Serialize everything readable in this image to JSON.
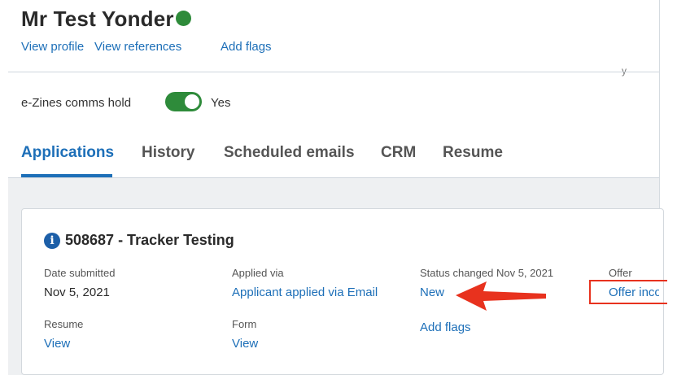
{
  "header": {
    "name": "Mr Test Yonder",
    "links": {
      "view_profile": "View profile",
      "view_references": "View references",
      "add_flags": "Add flags"
    }
  },
  "comms": {
    "label": "e-Zines comms hold",
    "toggle_on": true,
    "value": "Yes"
  },
  "tabs": [
    {
      "label": "Applications",
      "active": true
    },
    {
      "label": "History",
      "active": false
    },
    {
      "label": "Scheduled emails",
      "active": false
    },
    {
      "label": "CRM",
      "active": false
    },
    {
      "label": "Resume",
      "active": false
    }
  ],
  "application": {
    "title": "508687 - Tracker Testing",
    "date_submitted": {
      "label": "Date submitted",
      "value": "Nov 5, 2021"
    },
    "applied_via": {
      "label": "Applied via",
      "value": "Applicant applied via Email"
    },
    "status": {
      "label": "Status changed Nov 5, 2021",
      "value": "New"
    },
    "offer": {
      "label": "Offer",
      "value": "Offer incom"
    },
    "resume": {
      "label": "Resume",
      "value": "View"
    },
    "form": {
      "label": "Form",
      "value": "View"
    },
    "add_flags": "Add flags"
  },
  "colors": {
    "link": "#1d6fb8",
    "status_green": "#2e8b3a",
    "annotation_red": "#e8321e"
  }
}
